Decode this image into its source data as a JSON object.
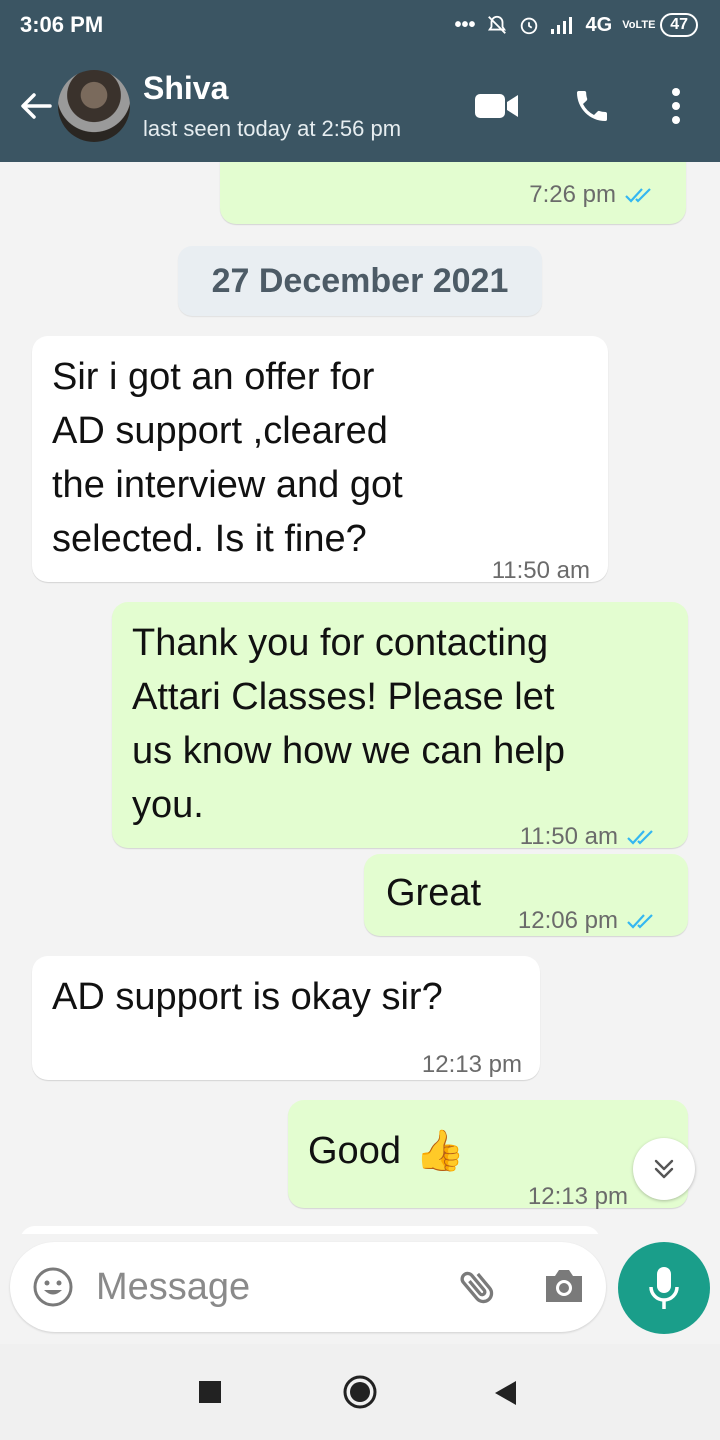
{
  "status_bar": {
    "time": "3:06 PM",
    "network": "4G",
    "volte": "VoLTE",
    "battery": "47"
  },
  "header": {
    "contact_name": "Shiva",
    "last_seen": "last seen today at 2:56 pm",
    "icons": [
      "back-arrow-icon",
      "video-call-icon",
      "phone-icon",
      "more-vert-icon"
    ]
  },
  "chat": {
    "prev_message_time": "7:26 pm",
    "date_separator": "27 December 2021",
    "messages": [
      {
        "direction": "incoming",
        "lines": [
          "Sir i got an offer for",
          "AD support ,cleared",
          "the interview and got",
          "selected. Is it fine?"
        ],
        "time": "11:50 am"
      },
      {
        "direction": "outgoing",
        "lines": [
          "Thank you for contacting",
          "Attari Classes! Please let",
          "us know how we can help",
          "you."
        ],
        "time": "11:50 am",
        "status": "read"
      },
      {
        "direction": "outgoing",
        "lines": [
          "Great"
        ],
        "time": "12:06 pm",
        "status": "read"
      },
      {
        "direction": "incoming",
        "lines": [
          "AD support is okay sir?"
        ],
        "time": "12:13 pm"
      },
      {
        "direction": "outgoing",
        "lines": [
          "Good"
        ],
        "emoji": "👍",
        "time": "12:13 pm",
        "status": "read"
      }
    ]
  },
  "composer": {
    "placeholder": "Message",
    "icons": [
      "emoji-icon",
      "attach-icon",
      "camera-icon",
      "mic-icon"
    ]
  },
  "colors": {
    "header_bg": "#3b5563",
    "outgoing_bubble": "#e3fdd0",
    "incoming_bubble": "#ffffff",
    "read_ticks": "#34b7f1",
    "mic_button": "#1a9e8a"
  }
}
